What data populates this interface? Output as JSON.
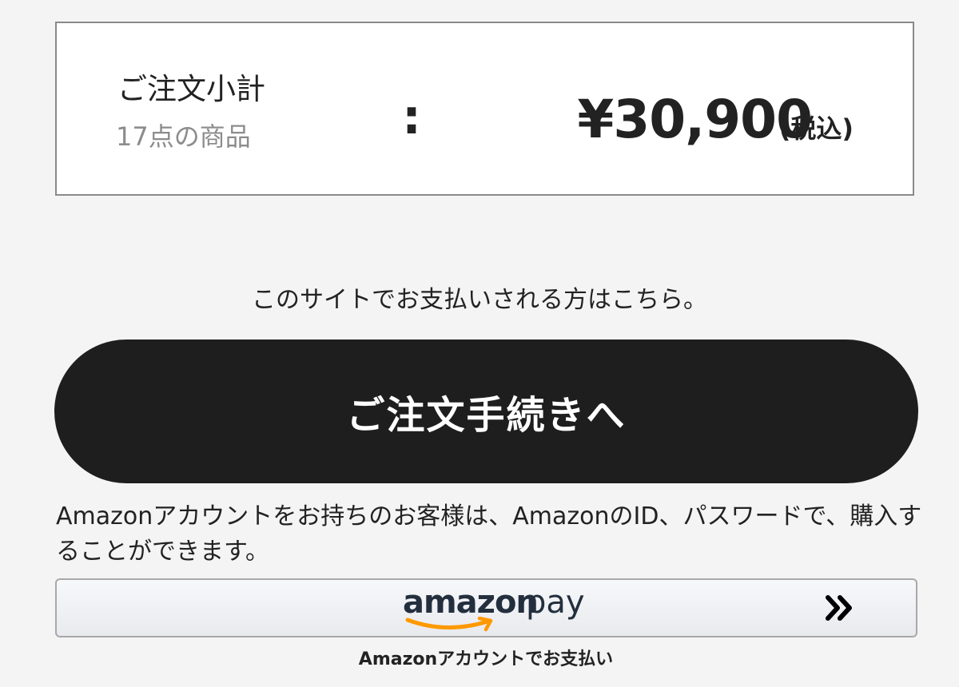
{
  "summary": {
    "title": "ご注文小計",
    "item_count": "17点の商品",
    "separator": ":",
    "price": "¥30,900",
    "tax_note": "(税込)"
  },
  "site_payment": {
    "note": "このサイトでお支払いされる方はこちら。",
    "checkout_label": "ご注文手続きへ"
  },
  "amazon_pay": {
    "note": "Amazonアカウントをお持ちのお客様は、AmazonのID、パスワードで、購入することができます。",
    "logo_word1": "amazon",
    "logo_word2": "pay",
    "caption": "Amazonアカウントでお支払い",
    "arrow_icon": "double-chevron-right-icon",
    "brand_color": "#232f3e",
    "smile_color": "#ff9900"
  },
  "colors": {
    "background": "#f4f4f4",
    "checkout_button": "#1e1e1e",
    "muted_text": "#8c8c8c"
  }
}
